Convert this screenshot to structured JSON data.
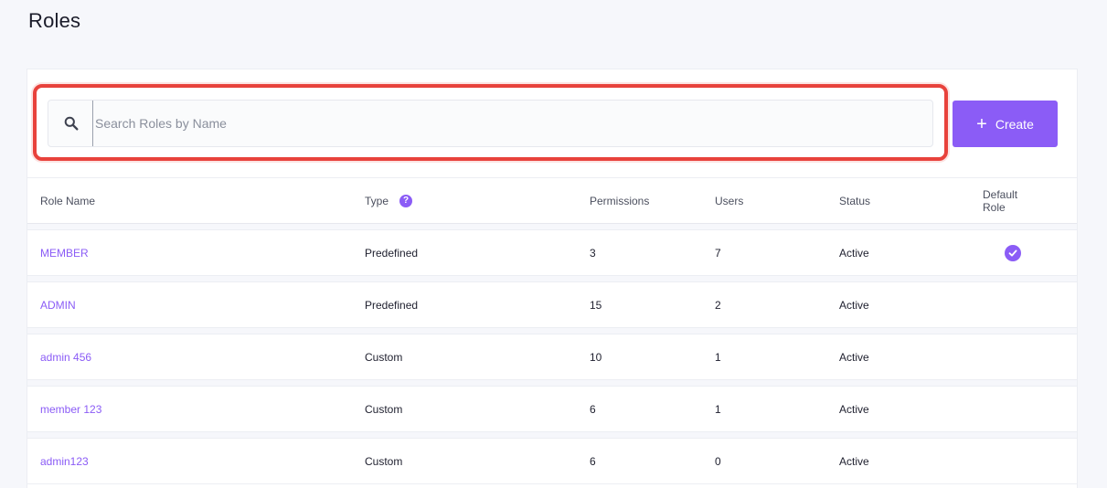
{
  "page": {
    "title": "Roles"
  },
  "search": {
    "placeholder": "Search Roles by Name",
    "value": ""
  },
  "toolbar": {
    "create_label": "Create"
  },
  "table": {
    "columns": {
      "role_name": "Role Name",
      "type": "Type",
      "type_help": "?",
      "permissions": "Permissions",
      "users": "Users",
      "status": "Status",
      "default_role": "Default Role"
    },
    "rows": [
      {
        "name": "MEMBER",
        "type": "Predefined",
        "permissions": "3",
        "users": "7",
        "status": "Active",
        "default": true
      },
      {
        "name": "ADMIN",
        "type": "Predefined",
        "permissions": "15",
        "users": "2",
        "status": "Active",
        "default": false
      },
      {
        "name": "admin 456",
        "type": "Custom",
        "permissions": "10",
        "users": "1",
        "status": "Active",
        "default": false
      },
      {
        "name": "member 123",
        "type": "Custom",
        "permissions": "6",
        "users": "1",
        "status": "Active",
        "default": false
      },
      {
        "name": "admin123",
        "type": "Custom",
        "permissions": "6",
        "users": "0",
        "status": "Active",
        "default": false
      }
    ]
  },
  "colors": {
    "accent": "#8b5cf6",
    "highlight": "#e8423c"
  },
  "icons": {
    "search": "search-icon",
    "create": "plus-icon",
    "help": "help-icon",
    "default": "check-circle-icon"
  }
}
